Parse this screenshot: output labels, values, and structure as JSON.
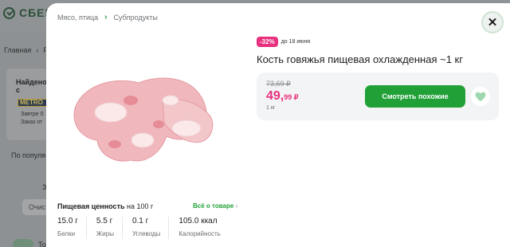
{
  "background": {
    "logo_text": "СБЕР",
    "breadcrumb": [
      "Главная",
      "Р"
    ],
    "found_title": "Найдено с",
    "store_logo": "METRO",
    "delivery_line1": "Завтре 0",
    "delivery_line2": "Заказ от",
    "sort_label": "По популя",
    "filter_label": "З",
    "filter_button": "Очис",
    "toggle_label": "То"
  },
  "modal": {
    "breadcrumbs": [
      "Мясо, птица",
      "Субпродукты"
    ],
    "discount_badge": "-32%",
    "discount_until": "до 18 июня",
    "product_title": "Кость говяжья пищевая охлажденная ~1 кг",
    "old_price": "73,69 ₽",
    "new_price_int": "49,",
    "new_price_frac": "99 ₽",
    "unit": "1 кг",
    "similar_button": "Смотреть похожие",
    "nutrition_title": "Пищевая ценность",
    "nutrition_per": "на 100 г",
    "all_about_link": "Всё о товаре",
    "nutrition": [
      {
        "value": "15.0 г",
        "name": "Белки"
      },
      {
        "value": "5.5 г",
        "name": "Жиры"
      },
      {
        "value": "0.1 г",
        "name": "Углеводы"
      },
      {
        "value": "105.0 ккал",
        "name": "Калорийность"
      }
    ]
  },
  "colors": {
    "accent_green": "#21a038",
    "discount_pink": "#e8307e",
    "overlay": "#8e9193"
  },
  "icons": {
    "close": "close-icon",
    "favorite": "heart-icon",
    "chevron": "chevron-right-icon"
  }
}
